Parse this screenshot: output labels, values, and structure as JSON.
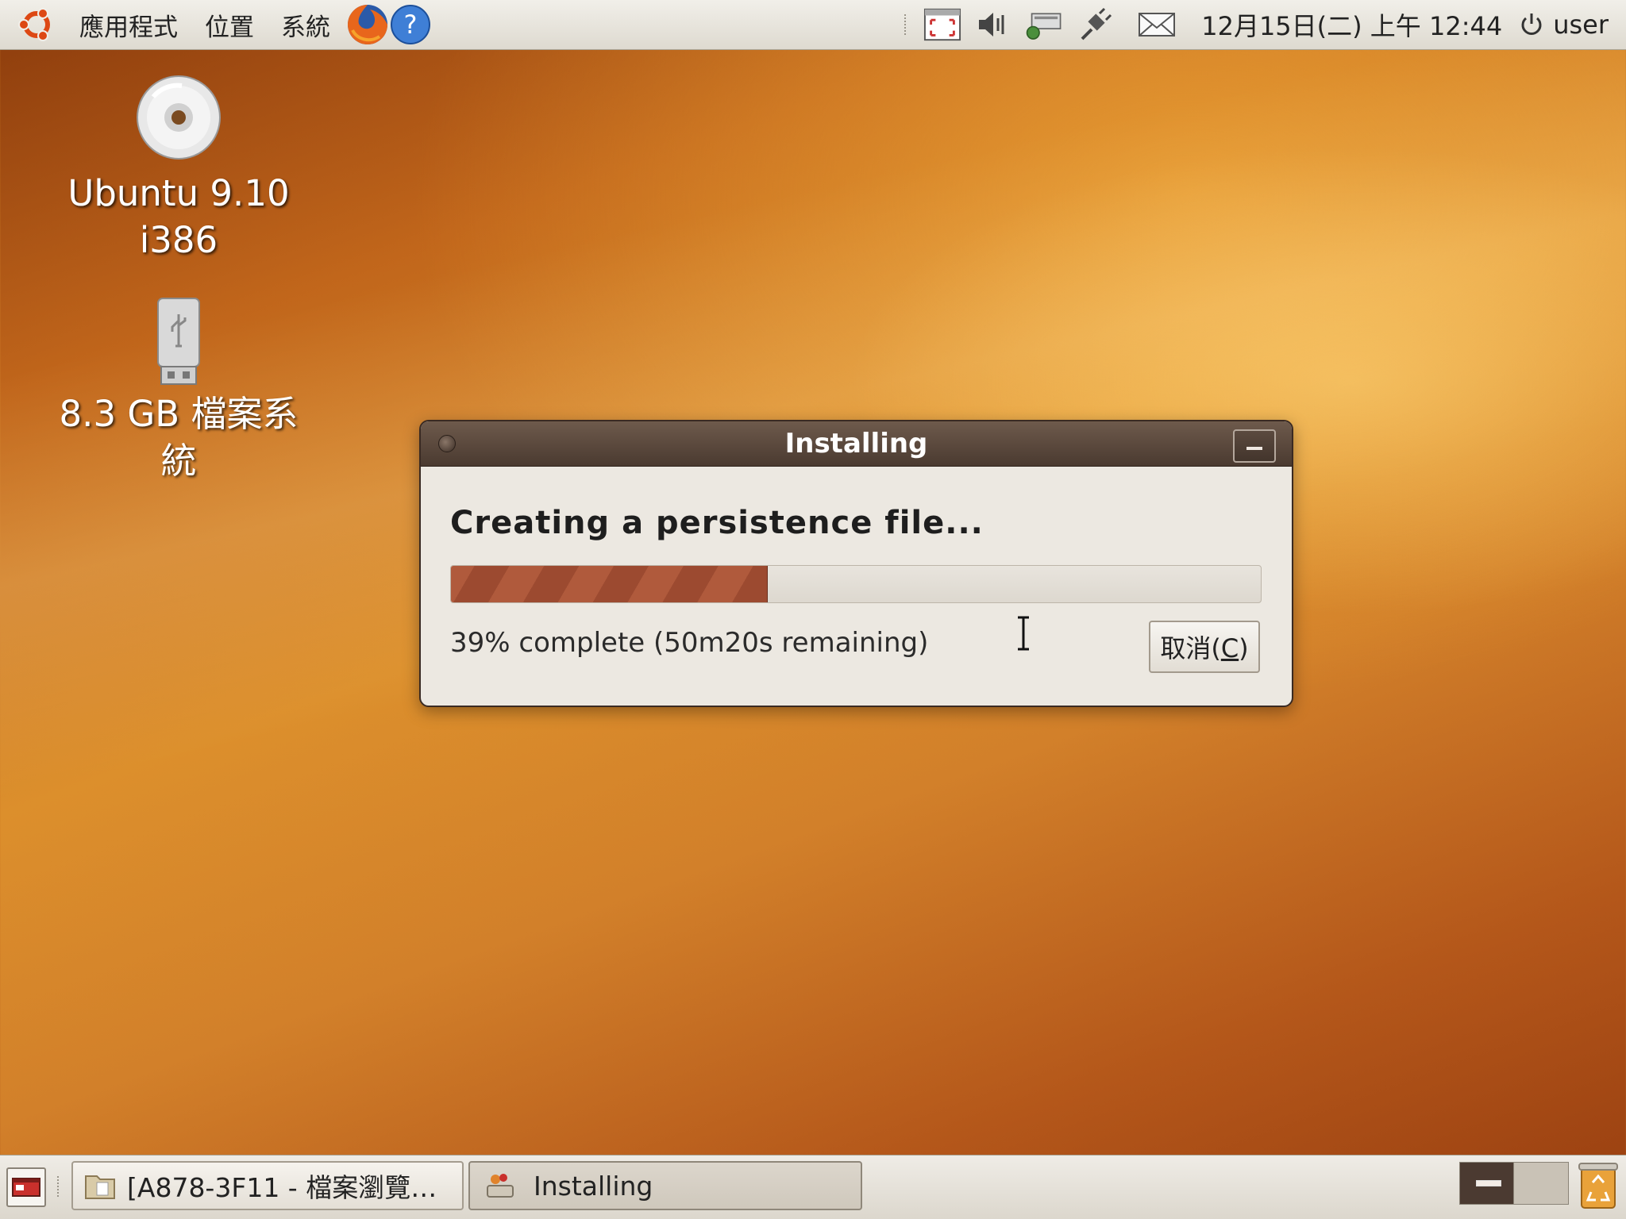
{
  "top_panel": {
    "menus": [
      "應用程式",
      "位置",
      "系統"
    ],
    "clock": "12月15日(二) 上午 12:44",
    "user": "user"
  },
  "desktop": {
    "icons": [
      {
        "label_line1": "Ubuntu 9.10",
        "label_line2": "i386",
        "icon": "cd-icon"
      },
      {
        "label_line1": "8.3 GB 檔案系",
        "label_line2": "統",
        "icon": "usb-drive-icon"
      }
    ]
  },
  "dialog": {
    "window_title": "Installing",
    "heading": "Creating a persistence file...",
    "progress": 0.39,
    "status": "39% complete (50m20s remaining)",
    "cancel_label": "取消(C)",
    "cancel_mnemonic": "C"
  },
  "taskbar": {
    "tasks": [
      {
        "label": "[A878-3F11 - 檔案瀏覽…",
        "icon": "folder-icon"
      },
      {
        "label": "Installing",
        "icon": "installer-icon"
      }
    ]
  },
  "colors": {
    "panel": "#e8e5de",
    "titlebar": "#5a4639",
    "progress": "#a5513a",
    "dialog_bg": "#ece8e1"
  }
}
